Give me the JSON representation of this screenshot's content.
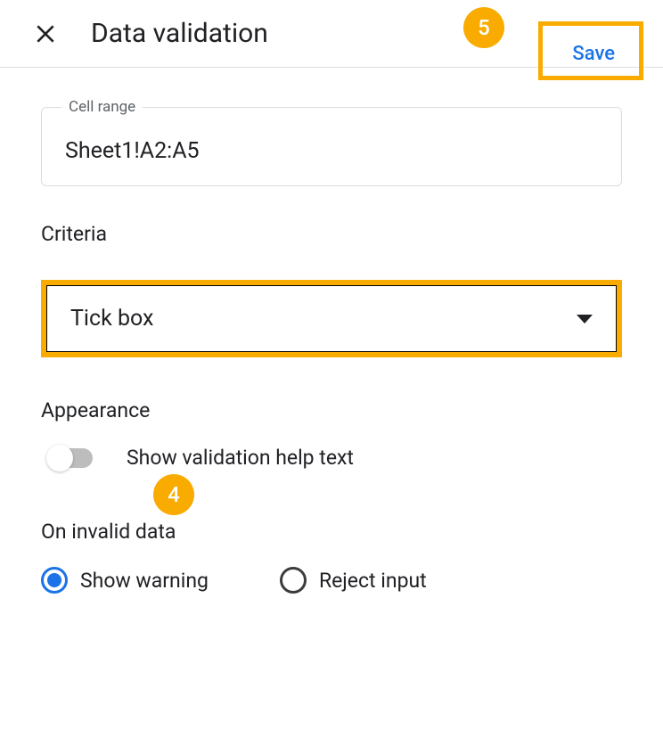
{
  "header": {
    "title": "Data validation",
    "save_label": "Save"
  },
  "callouts": {
    "step4": "4",
    "step5": "5"
  },
  "cell_range": {
    "label": "Cell range",
    "value": "Sheet1!A2:A5"
  },
  "criteria": {
    "label": "Criteria",
    "selected": "Tick box"
  },
  "appearance": {
    "label": "Appearance",
    "help_text_label": "Show validation help text",
    "help_text_enabled": false
  },
  "invalid_data": {
    "label": "On invalid data",
    "options": {
      "show_warning": "Show warning",
      "reject_input": "Reject input"
    },
    "selected": "show_warning"
  }
}
